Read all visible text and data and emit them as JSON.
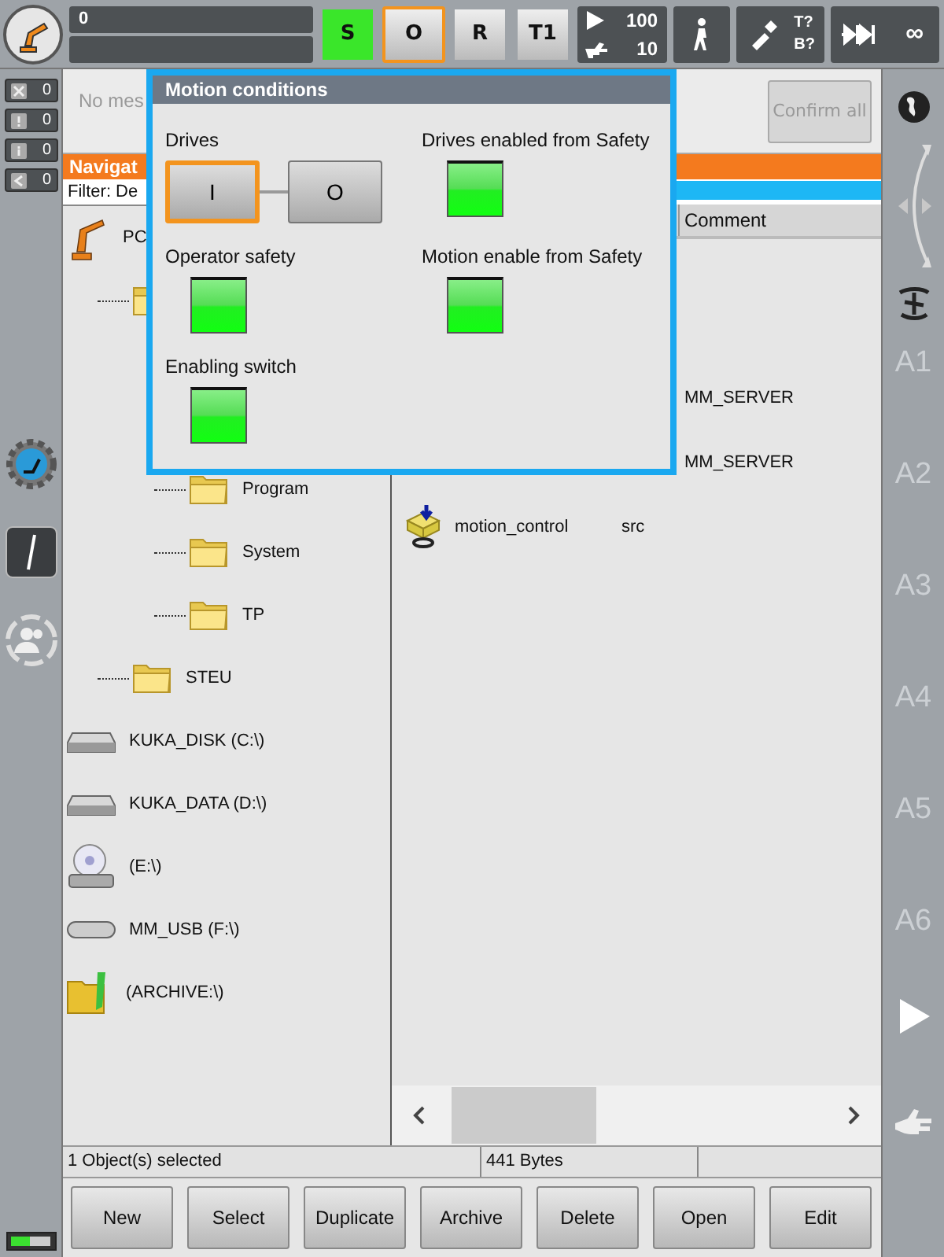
{
  "top_bar": {
    "status_text": "0",
    "mode_buttons": [
      {
        "label": "S",
        "active": true,
        "selected": false
      },
      {
        "label": "O",
        "active": false,
        "selected": true
      },
      {
        "label": "R",
        "active": false,
        "selected": false
      },
      {
        "label": "T1",
        "active": false,
        "selected": false
      }
    ],
    "override": {
      "program": "100",
      "jog": "10"
    },
    "tool_base": {
      "tool": "T?",
      "base": "B?"
    },
    "increment": "∞"
  },
  "message_counters": [
    {
      "kind": "error",
      "count": "0"
    },
    {
      "kind": "warning",
      "count": "0"
    },
    {
      "kind": "info",
      "count": "0"
    },
    {
      "kind": "wait",
      "count": "0"
    }
  ],
  "messages": {
    "text": "No mes",
    "confirm_all": {
      "label": "Confirm all",
      "disabled": true
    }
  },
  "navigator": {
    "title": "Navigat",
    "filter": "Filter: De",
    "tree": [
      {
        "kind": "robot",
        "label": "PC",
        "children": [
          {
            "kind": "folder",
            "children": [
              {
                "kind": "folder",
                "label": "Program"
              },
              {
                "kind": "folder",
                "label": "System"
              },
              {
                "kind": "folder",
                "label": "TP"
              }
            ]
          },
          {
            "kind": "folder",
            "label": "STEU"
          }
        ]
      },
      {
        "kind": "disk",
        "label": "KUKA_DISK (C:\\)"
      },
      {
        "kind": "disk",
        "label": "KUKA_DATA (D:\\)"
      },
      {
        "kind": "cd",
        "label": "(E:\\)"
      },
      {
        "kind": "usb",
        "label": "MM_USB (F:\\)"
      },
      {
        "kind": "archive",
        "label": "(ARCHIVE:\\)"
      }
    ]
  },
  "file_list": {
    "columns": [
      "Comment"
    ],
    "rows": [
      {
        "kind": "plain",
        "comment": "MM_SERVER"
      },
      {
        "kind": "plain",
        "comment": "MM_SERVER"
      },
      {
        "kind": "module",
        "name": "motion_control",
        "column_2": "src"
      }
    ]
  },
  "status_bar": [
    "1 Object(s) selected",
    "441 Bytes"
  ],
  "buttons": [
    "New",
    "Select",
    "Duplicate",
    "Archive",
    "Delete",
    "Open",
    "Edit"
  ],
  "axis_labels": [
    "A1",
    "A2",
    "A3",
    "A4",
    "A5",
    "A6"
  ],
  "motion_conditions": {
    "title": "Motion conditions",
    "drives": {
      "label": "Drives",
      "buttons": [
        {
          "label": "I",
          "selected": true
        },
        {
          "label": "O",
          "selected": false
        }
      ]
    },
    "indicators": [
      {
        "label": "Drives enabled from Safety",
        "on": true
      },
      {
        "label": "Operator safety",
        "on": true
      },
      {
        "label": "Motion enable from Safety",
        "on": true
      },
      {
        "label": "Enabling switch",
        "on": true
      }
    ]
  }
}
